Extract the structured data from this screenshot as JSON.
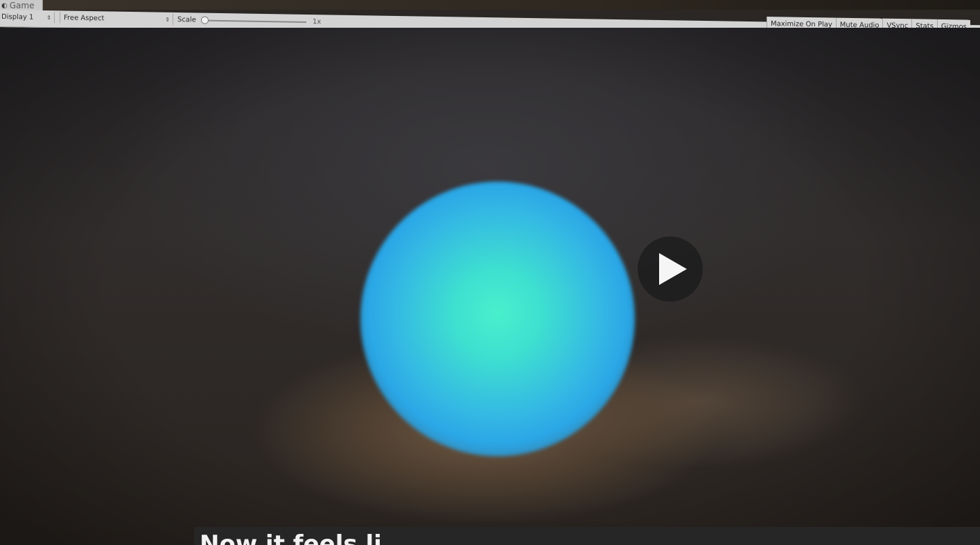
{
  "tab": {
    "title": "Game",
    "icon": "game-view-icon"
  },
  "toolbar": {
    "display_label": "Display 1",
    "aspect_label": "Free Aspect",
    "scale_label": "Scale",
    "scale_value": "1x",
    "scale_fraction": 0.0
  },
  "toggles": [
    {
      "label": "Maximize On Play"
    },
    {
      "label": "Mute Audio"
    },
    {
      "label": "VSync"
    },
    {
      "label": "Stats"
    },
    {
      "label": "Gizmos"
    }
  ],
  "overlay": {
    "play_icon": "play-icon",
    "caption": "Now it feels li"
  }
}
